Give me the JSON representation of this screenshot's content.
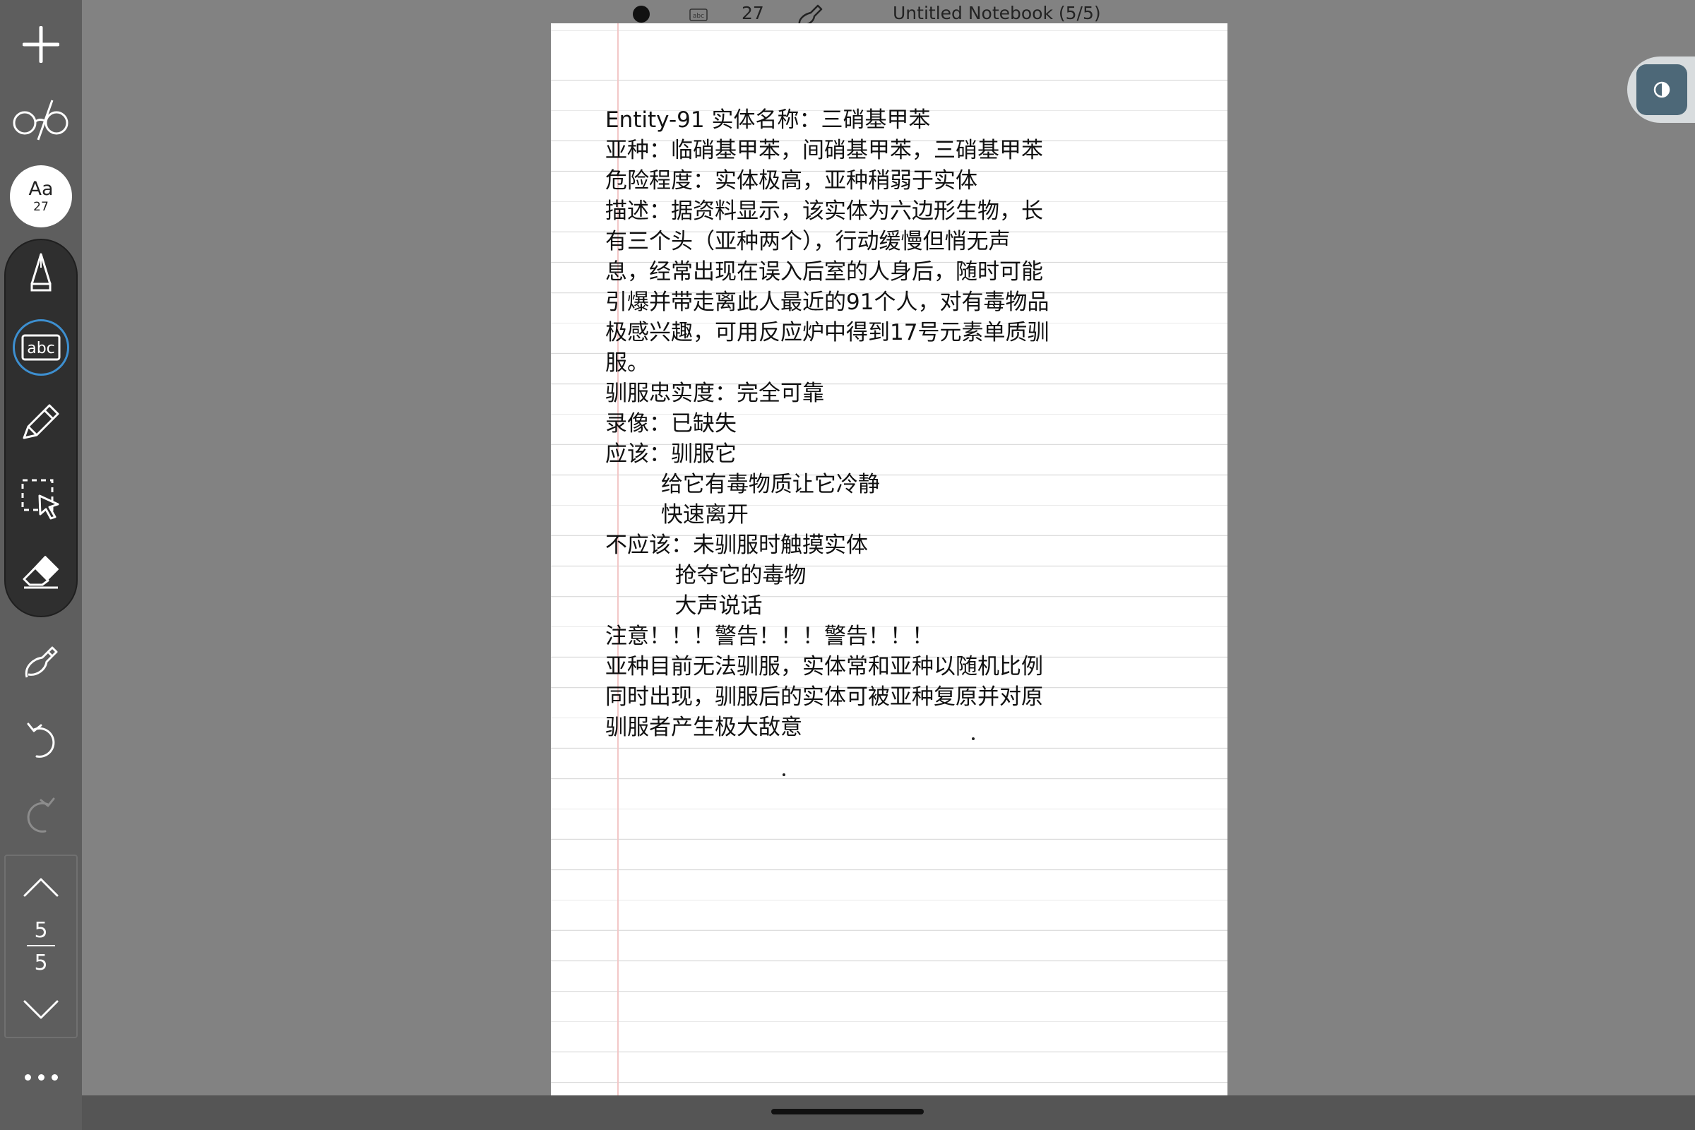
{
  "toolbar": {
    "font_button": {
      "label": "Aa",
      "size": "27"
    },
    "tools": [
      "add-icon",
      "glasses-icon",
      "pen-icon",
      "text-tool-icon",
      "highlighter-icon",
      "lasso-select-icon",
      "eraser-icon",
      "ink-gesture-icon",
      "undo-icon",
      "redo-icon"
    ],
    "active_tool": "text-tool",
    "page_nav": {
      "current": "5",
      "total": "5"
    }
  },
  "topbar": {
    "font_size": "27",
    "notebook_title": "Untitled Notebook (5/5)"
  },
  "note": {
    "lines": [
      "Entity-91 实体名称：三硝基甲苯",
      "亚种：临硝基甲苯，间硝基甲苯，三硝基甲苯",
      "危险程度：实体极高，亚种稍弱于实体",
      "描述：据资料显示，该实体为六边形生物，长",
      "有三个头（亚种两个），行动缓慢但悄无声",
      "息，经常出现在误入后室的人身后，随时可能",
      "引爆并带走离此人最近的91个人，对有毒物品",
      "极感兴趣，可用反应炉中得到17号元素单质驯",
      "服。",
      "驯服忠实度：完全可靠",
      "录像：已缺失",
      "应该：驯服它",
      "        给它有毒物质让它冷静",
      "        快速离开",
      "不应该：未驯服时触摸实体",
      "          抢夺它的毒物",
      "          大声说话",
      "注意！！！警告！！！警告！！！",
      "亚种目前无法驯服，实体常和亚种以随机比例",
      "同时出现，驯服后的实体可被亚种复原并对原",
      "驯服者产生极大敌意"
    ]
  },
  "colors": {
    "toolbar_bg": "#5e5e5e",
    "tool_group_bg": "#2f2f2f",
    "active_ring": "#3d8fd0",
    "canvas_bg": "#828282",
    "contrast_button": "#4d6878"
  }
}
